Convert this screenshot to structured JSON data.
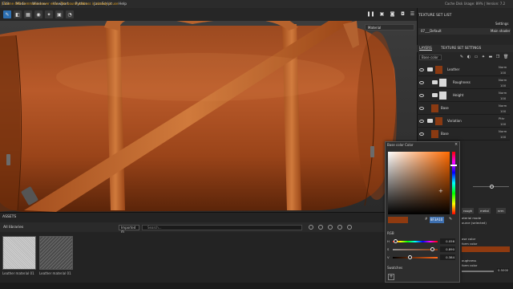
{
  "menu": [
    "Edit",
    "Mode",
    "Window",
    "Viewport",
    "Python",
    "JavaScript",
    "Help"
  ],
  "viewport": {
    "material_dropdown": "Material"
  },
  "right_panel": {
    "texture_set_list_title": "TEXTURE SET LIST",
    "settings_label": "Settings",
    "texture_set_name": "07___Default",
    "shader_name": "Main shader",
    "tabs": [
      "LAYERS",
      "TEXTURE SET SETTINGS"
    ],
    "blend_select": "Base color",
    "layers": [
      {
        "name": "Leather",
        "blend": "Norm",
        "opacity": "100",
        "type": "folder",
        "thumb": "#8a3a12"
      },
      {
        "name": "Roughness",
        "blend": "Norm",
        "opacity": "100",
        "type": "fill",
        "thumb": "#d8d8d8"
      },
      {
        "name": "Height",
        "blend": "Norm",
        "opacity": "100",
        "type": "fill",
        "thumb": "#d8d8d8"
      },
      {
        "name": "Base",
        "blend": "Norm",
        "opacity": "100",
        "type": "paint",
        "thumb": "#8a3a12"
      },
      {
        "name": "Variation",
        "blend": "Pthr",
        "opacity": "100",
        "type": "folder",
        "thumb": "#8a3a12"
      },
      {
        "name": "Base",
        "blend": "Norm",
        "opacity": "100",
        "type": "paint",
        "thumb": "#8a3a12"
      }
    ]
  },
  "properties": {
    "buttons": [
      "rough",
      "metal",
      "nrm"
    ],
    "material_mode_label": "aterial mode",
    "material_mode_value": "ource (selected)",
    "base_color_label": "ase color",
    "base_color_sub": "form color",
    "roughness_label": "oughness",
    "roughness_sub": "form color",
    "roughness_value": "0.5000",
    "base_color_swatch": "#8f3a10"
  },
  "color_picker": {
    "title": "Base color Color",
    "hex_value": "8F3A10",
    "current_color": "#8f3a10",
    "mode": "RGB",
    "channels": [
      {
        "label": "H",
        "value": "0.056",
        "fraction": 0.056
      },
      {
        "label": "S",
        "value": "0.890",
        "fraction": 0.89
      },
      {
        "label": "V",
        "value": "0.384",
        "fraction": 0.384
      }
    ],
    "swatches_label": "Swatches",
    "add_swatch": "+"
  },
  "assets": {
    "title": "ASSETS",
    "all_libraries": "All libraries",
    "filter": "Imported m",
    "search_placeholder": "Search...",
    "items": [
      {
        "label": "Leather material 01"
      },
      {
        "label": "Leather material 01"
      }
    ]
  },
  "status": {
    "error_text": "[ Scene 440 Command server error: The bound address is already in use",
    "right_text": "Cache Disk Usage:   89%  |  Version: 7.2"
  }
}
